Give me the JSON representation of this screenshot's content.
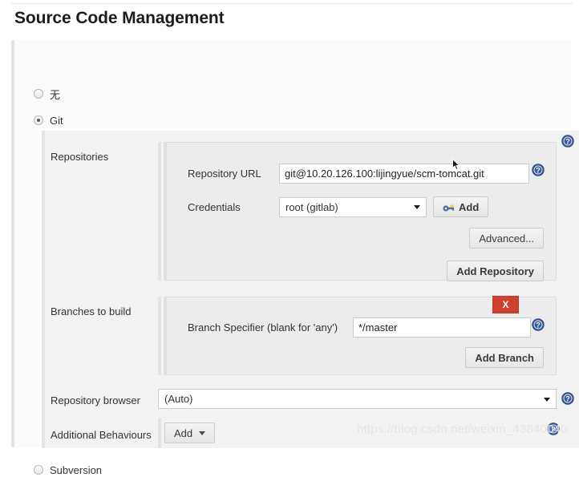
{
  "page": {
    "title": "Source Code Management"
  },
  "scm_options": [
    {
      "label": "无",
      "checked": false,
      "name": "none"
    },
    {
      "label": "Git",
      "checked": true,
      "name": "git"
    },
    {
      "label": "Subversion",
      "checked": false,
      "name": "subversion"
    }
  ],
  "git": {
    "repositories": {
      "section_label": "Repositories",
      "repository_url": {
        "label": "Repository URL",
        "value": "git@10.20.126.100:lijingyue/scm-tomcat.git"
      },
      "credentials": {
        "label": "Credentials",
        "selected": "root (gitlab)",
        "add_button": "Add",
        "add_icon": "key-icon"
      },
      "advanced_button": "Advanced...",
      "add_repository_button": "Add Repository"
    },
    "branches": {
      "section_label": "Branches to build",
      "branch_specifier": {
        "label": "Branch Specifier (blank for 'any')",
        "value": "*/master"
      },
      "delete_button": "X",
      "add_branch_button": "Add Branch"
    },
    "repository_browser": {
      "label": "Repository browser",
      "selected": "(Auto)"
    },
    "additional_behaviours": {
      "label": "Additional Behaviours",
      "add_button": "Add"
    }
  },
  "watermark": "https://blog.csdn.net/weixin_43840040",
  "colors": {
    "accent_help": "#3b5c9c",
    "delete_red": "#d0402f",
    "panel_bg": "#ececec",
    "section_bg": "#f2f2f2"
  }
}
